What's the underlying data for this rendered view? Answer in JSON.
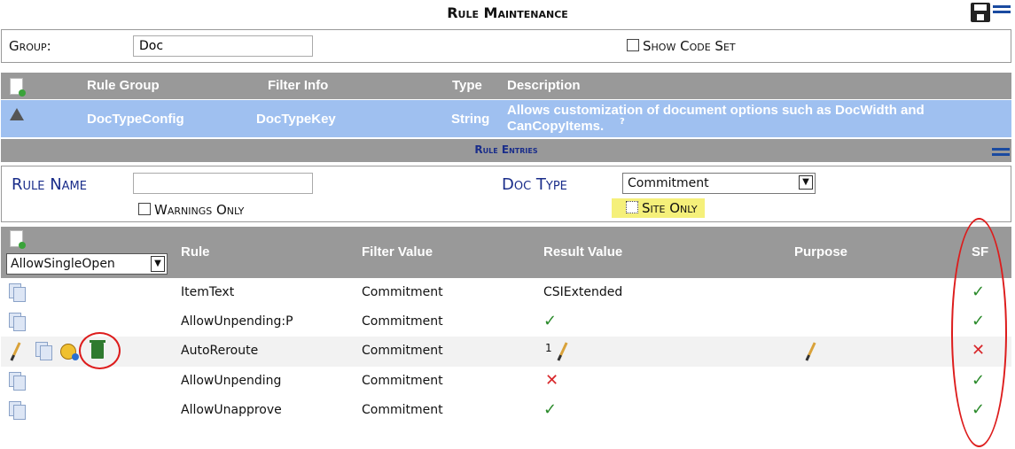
{
  "title": "Rule Maintenance",
  "group": {
    "label": "Group:",
    "value": "Doc",
    "show_code_set": "Show Code Set"
  },
  "group_table": {
    "headers": {
      "rule_group": "Rule Group",
      "filter_info": "Filter Info",
      "type": "Type",
      "description": "Description"
    },
    "row": {
      "rule_group": "DocTypeConfig",
      "filter_info": "DocTypeKey",
      "type": "String",
      "description_line1": "Allows customization of document options such as DocWidth and",
      "description_line2": "CanCopyItems.",
      "help": "?"
    }
  },
  "entries_title": "Rule Entries",
  "filters": {
    "rule_name_label": "Rule Name",
    "rule_name_value": "",
    "warnings_only": "Warnings Only",
    "doc_type_label": "Doc Type",
    "doc_type_value": "Commitment",
    "site_only": "Site Only"
  },
  "table": {
    "dropdown_value": "AllowSingleOpen",
    "headers": {
      "rule": "Rule",
      "filter_value": "Filter Value",
      "result_value": "Result Value",
      "purpose": "Purpose",
      "sf": "SF"
    },
    "rows": [
      {
        "rule": "ItemText",
        "filter": "Commitment",
        "result": "CSIExtended"
      },
      {
        "rule": "AllowUnpending:P",
        "filter": "Commitment",
        "result": "✓"
      },
      {
        "rule": "AutoReroute",
        "filter": "Commitment",
        "result": "1"
      },
      {
        "rule": "AllowUnpending",
        "filter": "Commitment",
        "result": "✕"
      },
      {
        "rule": "AllowUnapprove",
        "filter": "Commitment",
        "result": "✓"
      }
    ],
    "sf": [
      "✓",
      "✓",
      "✕",
      "✓",
      "✓"
    ]
  },
  "colors": {
    "header_gray": "#999999",
    "selected_row": "#9fc0f0",
    "accent_blue": "#1a2d8a",
    "highlight": "#f5f07a",
    "annotation_red": "#dd1c1c"
  }
}
